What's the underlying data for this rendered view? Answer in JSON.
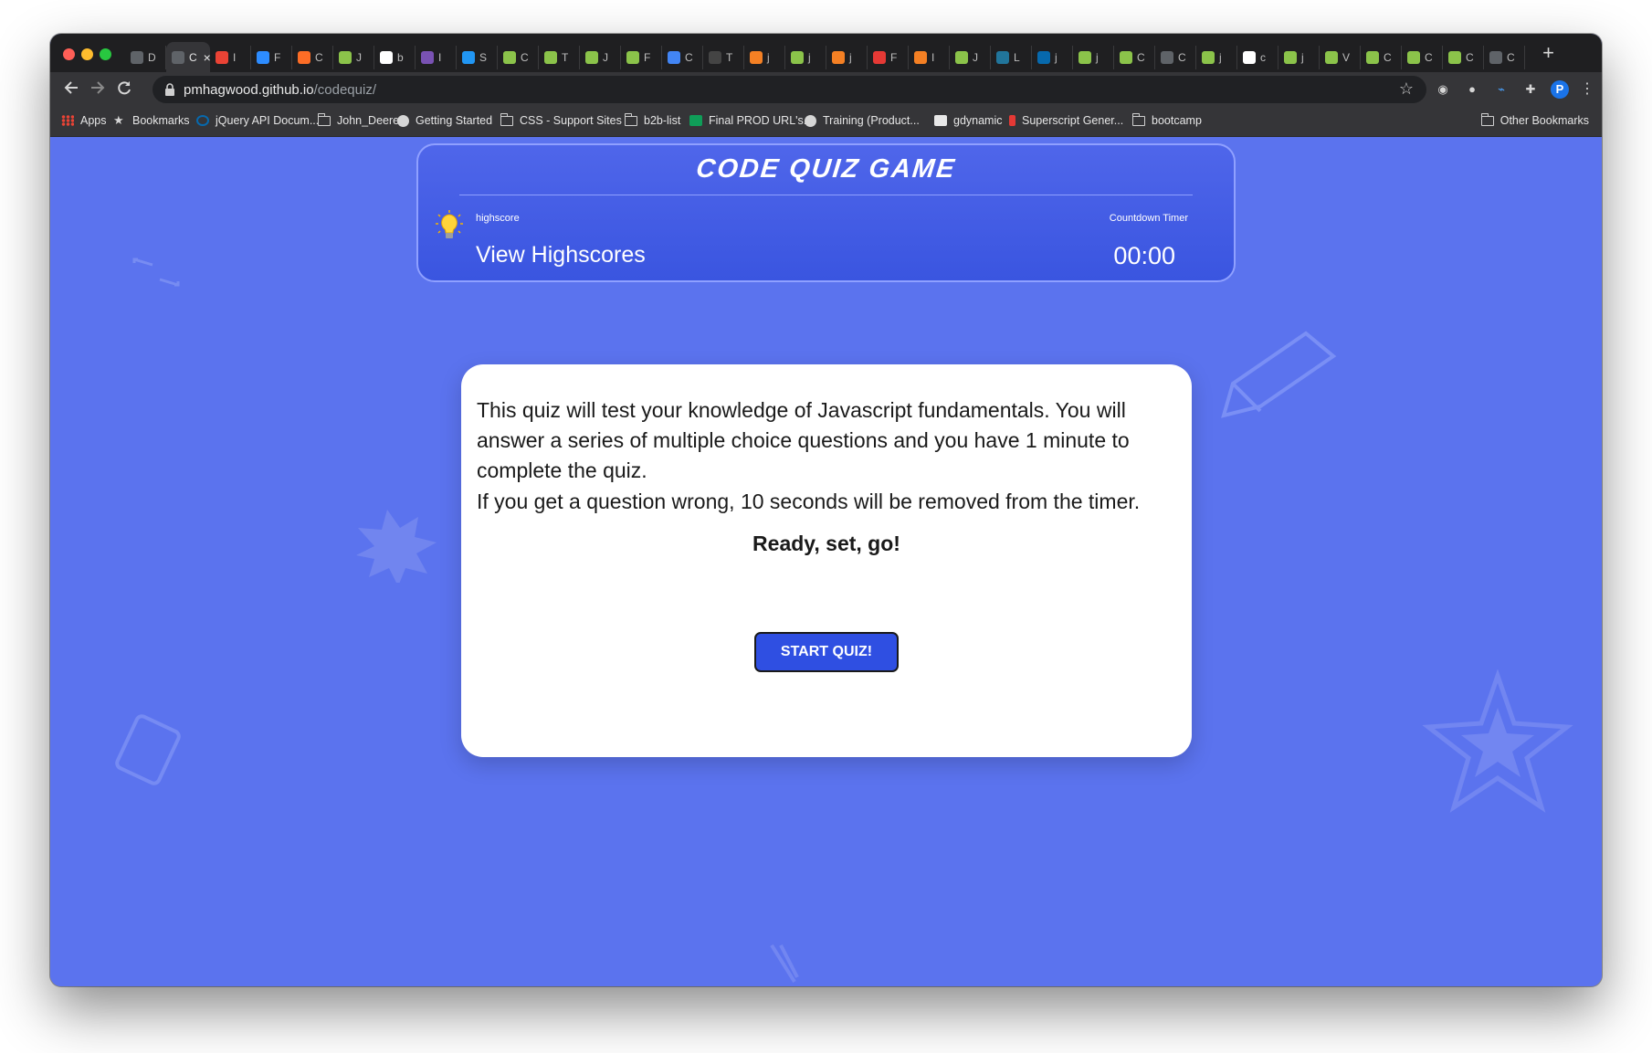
{
  "browser": {
    "tabs": [
      {
        "icon": "globe-icon",
        "color": "#5f6368",
        "text": "D"
      },
      {
        "icon": "page-icon",
        "color": "#5f6368",
        "text": "C"
      },
      {
        "icon": "gmail-icon",
        "color": "#ea4335",
        "text": "I"
      },
      {
        "icon": "zoom-icon",
        "color": "#2d8cff",
        "text": "F"
      },
      {
        "icon": "gitlab-icon",
        "color": "#fc6d26",
        "text": "C"
      },
      {
        "icon": "image-icon",
        "color": "#8bc34a",
        "text": "J"
      },
      {
        "icon": "google-icon",
        "color": "#ffffff",
        "text": "b"
      },
      {
        "icon": "bootstrap-icon",
        "color": "#7952b3",
        "text": "I"
      },
      {
        "icon": "dots-icon",
        "color": "#2196f3",
        "text": "S"
      },
      {
        "icon": "image-icon",
        "color": "#8bc34a",
        "text": "C"
      },
      {
        "icon": "image-icon",
        "color": "#8bc34a",
        "text": "T"
      },
      {
        "icon": "image-icon",
        "color": "#8bc34a",
        "text": "J"
      },
      {
        "icon": "image-icon",
        "color": "#8bc34a",
        "text": "F"
      },
      {
        "icon": "docs-icon",
        "color": "#4285f4",
        "text": "C"
      },
      {
        "icon": "check-icon",
        "color": "#444444",
        "text": "T"
      },
      {
        "icon": "stack-icon",
        "color": "#f48024",
        "text": "j"
      },
      {
        "icon": "image-icon",
        "color": "#8bc34a",
        "text": "j"
      },
      {
        "icon": "stack-icon",
        "color": "#f48024",
        "text": "j"
      },
      {
        "icon": "gear-icon",
        "color": "#e53935",
        "text": "F"
      },
      {
        "icon": "stack-icon",
        "color": "#f48024",
        "text": "I"
      },
      {
        "icon": "image-icon",
        "color": "#8bc34a",
        "text": "J"
      },
      {
        "icon": "wordpress-icon",
        "color": "#21759b",
        "text": "L"
      },
      {
        "icon": "jquery-icon",
        "color": "#0769ad",
        "text": "j"
      },
      {
        "icon": "image-icon",
        "color": "#8bc34a",
        "text": "j"
      },
      {
        "icon": "image-icon",
        "color": "#8bc34a",
        "text": "C"
      },
      {
        "icon": "globe-icon",
        "color": "#5f6368",
        "text": "C"
      },
      {
        "icon": "image-icon",
        "color": "#8bc34a",
        "text": "j"
      },
      {
        "icon": "google-icon",
        "color": "#ffffff",
        "text": "c"
      },
      {
        "icon": "image-icon",
        "color": "#8bc34a",
        "text": "j"
      },
      {
        "icon": "image-icon",
        "color": "#8bc34a",
        "text": "V"
      },
      {
        "icon": "image-icon",
        "color": "#8bc34a",
        "text": "C"
      },
      {
        "icon": "image-icon",
        "color": "#8bc34a",
        "text": "C"
      },
      {
        "icon": "image-icon",
        "color": "#8bc34a",
        "text": "C"
      },
      {
        "icon": "globe-icon",
        "color": "#5f6368",
        "text": "C"
      }
    ],
    "active_tab_text": "C",
    "new_tab_symbol": "+",
    "url_host": "pmhagwood.github.io",
    "url_path": "/codequiz/",
    "profile_initial": "P",
    "bookmarks": [
      {
        "label": "Apps",
        "icon": "apps-grid-icon"
      },
      {
        "label": "Bookmarks",
        "icon": "star-icon"
      },
      {
        "label": "jQuery API Docum...",
        "icon": "jquery-icon"
      },
      {
        "label": "John_Deere",
        "icon": "folder-icon"
      },
      {
        "label": "Getting Started",
        "icon": "globe-icon"
      },
      {
        "label": "CSS - Support Sites",
        "icon": "folder-icon"
      },
      {
        "label": "b2b-list",
        "icon": "folder-icon"
      },
      {
        "label": "Final PROD URL's...",
        "icon": "sheets-icon"
      },
      {
        "label": "Training (Product...",
        "icon": "globe-icon"
      },
      {
        "label": "gdynamic",
        "icon": "image-icon"
      },
      {
        "label": "Superscript Gener...",
        "icon": "bottle-icon"
      },
      {
        "label": "bootcamp",
        "icon": "folder-icon"
      }
    ],
    "other_bookmarks": "Other Bookmarks"
  },
  "quiz": {
    "title": "CODE QUIZ GAME",
    "highscore_label": "highscore",
    "view_highscores": "View Highscores",
    "timer_label": "Countdown Timer",
    "timer_value": "00:00",
    "intro_1": "This quiz will test your knowledge of Javascript fundamentals. You will answer a series of multiple choice questions and you have 1 minute to complete the quiz.",
    "intro_2": "If you get a question wrong, 10 seconds will be removed from the timer.",
    "ready": "Ready, set, go!",
    "start_button": "START QUIZ!"
  },
  "colors": {
    "page_bg": "#5b73ee",
    "header_bg": "#3a55e0",
    "button_bg": "#2f4fe2"
  }
}
